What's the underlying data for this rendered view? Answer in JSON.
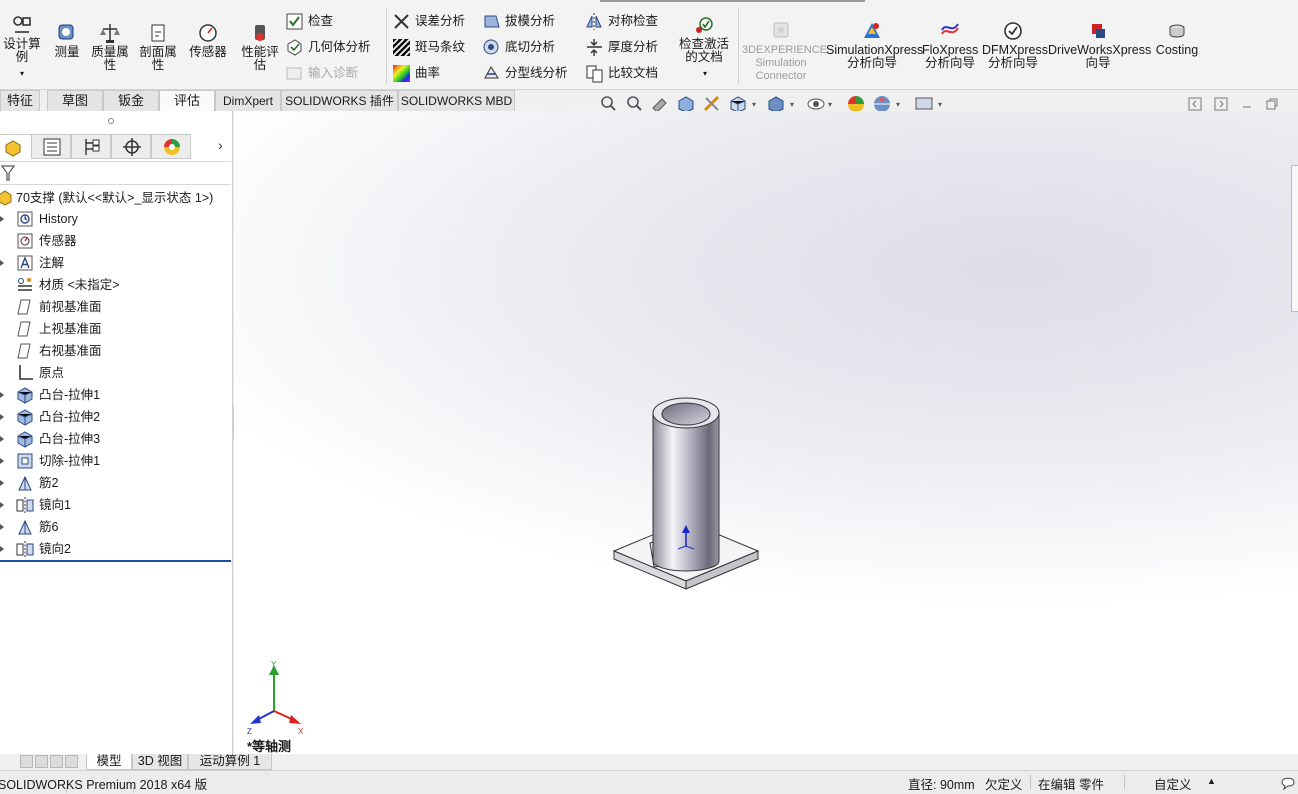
{
  "ribbon": {
    "design_study": "设计算例",
    "measure": "测量",
    "mass_properties": "质量属性",
    "section_properties": "剖面属性",
    "sensor": "传感器",
    "performance_eval": "性能评估",
    "check": "检查",
    "geometry_analysis": "几何体分析",
    "import_diagnostics": "输入诊断",
    "deviation_analysis": "误差分析",
    "zebra_stripes": "斑马条纹",
    "curvature": "曲率",
    "draft_analysis": "拔模分析",
    "undercut_analysis": "底切分析",
    "parting_line_analysis": "分型线分析",
    "symmetry_check": "对称检查",
    "thickness_analysis": "厚度分析",
    "compare_documents": "比较文档",
    "check_active_doc": "检查激活的文档",
    "experience_sim": "3DEXPERIENCE Simulation Connector",
    "simulationxpress": "SimulationXpress 分析向导",
    "floxpress": "FloXpress 分析向导",
    "dfmxpress": "DFMXpress 分析向导",
    "driveworksxpress": "DriveWorksXpress 向导",
    "costing": "Costing"
  },
  "tabs": [
    "特征",
    "草图",
    "钣金",
    "评估",
    "DimXpert",
    "SOLIDWORKS 插件",
    "SOLIDWORKS MBD"
  ],
  "active_tab": "评估",
  "tree": {
    "root": "70支撑 (默认<<默认>_显示状态 1>)",
    "items": [
      {
        "label": "History",
        "icon": "history-icon",
        "expandable": true
      },
      {
        "label": "传感器",
        "icon": "sensor-icon",
        "expandable": false
      },
      {
        "label": "注解",
        "icon": "annotation-icon",
        "expandable": true
      },
      {
        "label": "材质 <未指定>",
        "icon": "material-icon",
        "expandable": false
      },
      {
        "label": "前视基准面",
        "icon": "plane-icon",
        "expandable": false
      },
      {
        "label": "上视基准面",
        "icon": "plane-icon",
        "expandable": false
      },
      {
        "label": "右视基准面",
        "icon": "plane-icon",
        "expandable": false
      },
      {
        "label": "原点",
        "icon": "origin-icon",
        "expandable": false
      },
      {
        "label": "凸台-拉伸1",
        "icon": "boss-extrude-icon",
        "expandable": true
      },
      {
        "label": "凸台-拉伸2",
        "icon": "boss-extrude-icon",
        "expandable": true
      },
      {
        "label": "凸台-拉伸3",
        "icon": "boss-extrude-icon",
        "expandable": true
      },
      {
        "label": "切除-拉伸1",
        "icon": "cut-extrude-icon",
        "expandable": true
      },
      {
        "label": "筋2",
        "icon": "rib-icon",
        "expandable": true
      },
      {
        "label": "镜向1",
        "icon": "mirror-icon",
        "expandable": true
      },
      {
        "label": "筋6",
        "icon": "rib-icon",
        "expandable": true
      },
      {
        "label": "镜向2",
        "icon": "mirror-icon",
        "expandable": true
      }
    ]
  },
  "viewport": {
    "view_label": "*等轴测",
    "triad": {
      "x": "X",
      "y": "Y",
      "z": "Z"
    }
  },
  "bottom_tabs": [
    "模型",
    "3D 视图",
    "运动算例 1"
  ],
  "active_bottom_tab": "模型",
  "status": {
    "product": "SOLIDWORKS Premium 2018 x64 版",
    "measurement": "直径: 90mm",
    "definition": "欠定义",
    "edit_mode": "在编辑 零件",
    "units": "自定义"
  },
  "colors": {
    "accent_blue": "#1e4f9c",
    "ribbon_bg": "#f3f3f3",
    "viewport_bg": "#ecedf2"
  }
}
